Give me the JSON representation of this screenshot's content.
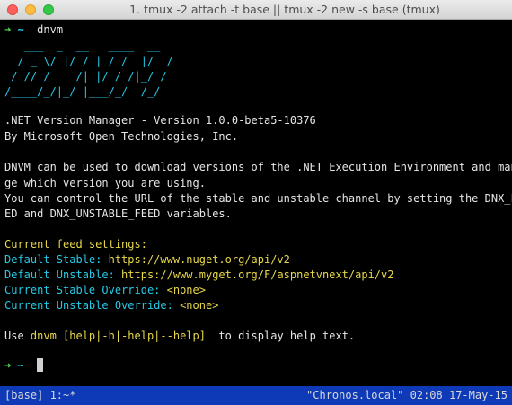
{
  "window": {
    "title": "1. tmux -2 attach -t base || tmux -2 new -s base (tmux)"
  },
  "terminal": {
    "prompt_symbol": "➜",
    "prompt_dir": "~",
    "command": "dnvm",
    "ascii_art": [
      "   ___  _  __   ____  __",
      "  / _ \\/ |/ / | / /  |/  /",
      " / // /    /| |/ / /|_/ /",
      "/____/_/|_/ |___/_/  /_/"
    ],
    "version_line": ".NET Version Manager - Version 1.0.0-beta5-10376",
    "author_line": "By Microsoft Open Technologies, Inc.",
    "desc_lines": [
      "DNVM can be used to download versions of the .NET Execution Environment and mana",
      "ge which version you are using.",
      "You can control the URL of the stable and unstable channel by setting the DNX_FE",
      "ED and DNX_UNSTABLE_FEED variables."
    ],
    "feed_heading": "Current feed settings:",
    "feeds": [
      {
        "label": "Default Stable: ",
        "value": "https://www.nuget.org/api/v2"
      },
      {
        "label": "Default Unstable: ",
        "value": "https://www.myget.org/F/aspnetvnext/api/v2"
      },
      {
        "label": "Current Stable Override: ",
        "value": "<none>"
      },
      {
        "label": "Current Unstable Override: ",
        "value": "<none>"
      }
    ],
    "usage_prefix": "Use ",
    "usage_command": "dnvm [help|-h|-help|--help]",
    "usage_suffix": "  to display help text."
  },
  "status_bar": {
    "left": "[base] 1:~*",
    "right": "\"Chronos.local\" 02:08 17-May-15"
  },
  "colors": {
    "prompt": "#50e04a",
    "ascii_art": "#26c9e6",
    "label": "#26c9e6",
    "value": "#e8d84a",
    "status_bg": "#0e3ab8"
  }
}
